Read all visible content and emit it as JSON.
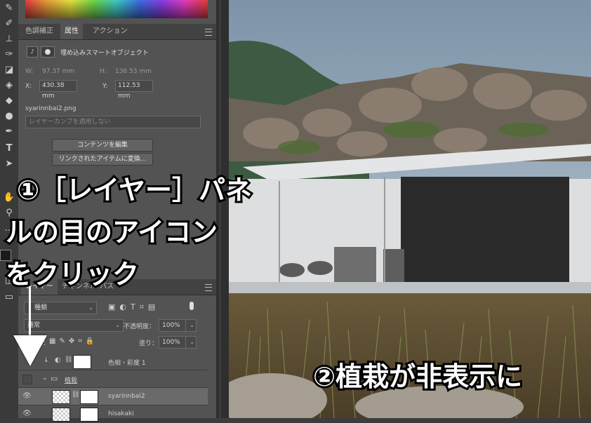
{
  "colors": {
    "accent": "#ffffff",
    "panel": "#535353",
    "dark": "#3c3c3c"
  },
  "tools": [
    "brush-tool",
    "paint-brush-icon",
    "stamp-icon",
    "healing-icon",
    "eraser-icon",
    "bucket-icon",
    "smudge-icon",
    "dodge-icon",
    "pen-icon",
    "type-icon",
    "select-arrow-icon",
    "hand-icon",
    "zoom-icon",
    "more-icon"
  ],
  "props_panel": {
    "tabs": [
      "色調補正",
      "属性",
      "アクション"
    ],
    "active_tab": "属性",
    "object_type": "埋め込みスマートオブジェクト",
    "w_label": "W:",
    "w_value": "97.37 mm",
    "h_label": "H:",
    "h_value": "136.53 mm",
    "x_label": "X:",
    "x_value": "430.38 mm",
    "y_label": "Y:",
    "y_value": "112.53 mm",
    "filename": "syarinnbai2.png",
    "comp_placeholder": "レイヤーカンプを適用しない",
    "edit_contents": "コンテンツを編集",
    "replace_linked": "リンクされたアイテムに変換..."
  },
  "layers_panel": {
    "tabs": [
      "レイヤー",
      "チャンネル",
      "パス"
    ],
    "filter_kind": "種類",
    "blend_mode": "通常",
    "opacity_label": "不透明度：",
    "opacity_value": "100%",
    "lock_label": "ロック：",
    "fill_label": "塗り：",
    "fill_value": "100%",
    "layers": [
      {
        "name": "色相・彩度 1",
        "type": "adjustment"
      },
      {
        "name": "植栽",
        "type": "group"
      },
      {
        "name": "syarinnbai2",
        "type": "smart"
      },
      {
        "name": "hisakaki",
        "type": "smart"
      }
    ]
  },
  "annotations": {
    "step1_line1": "①［レイヤー］パネ",
    "step1_line2": "ルの目のアイコン",
    "step1_line3": "をクリック",
    "step2": "②植栽が非表示に"
  }
}
